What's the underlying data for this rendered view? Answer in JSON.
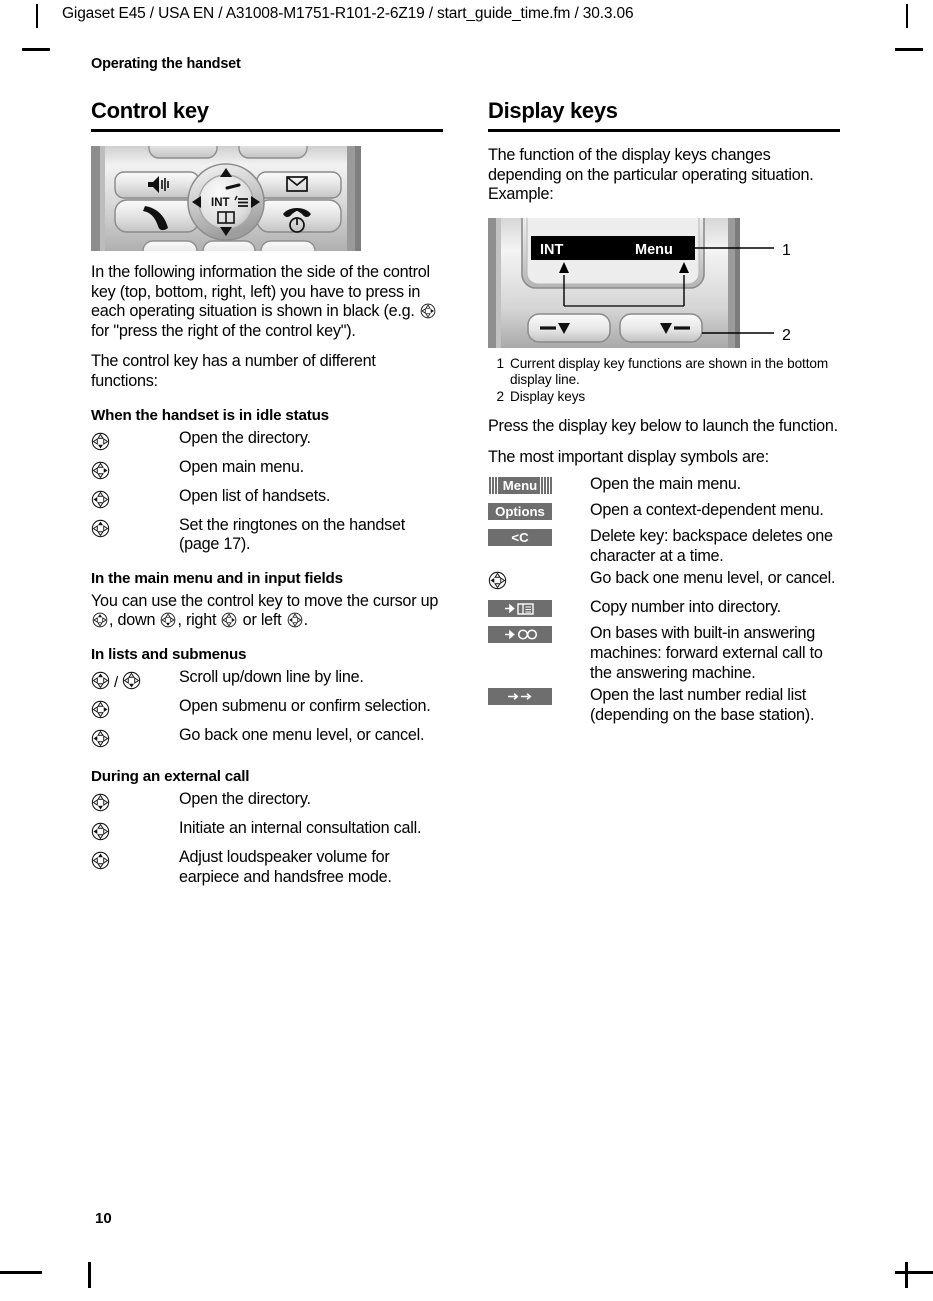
{
  "page": {
    "running_head": "Gigaset E45 / USA EN / A31008-M1751-R101-2-6Z19  / start_guide_time.fm / 30.3.06",
    "chapter": "Operating the handset",
    "folio": "10"
  },
  "left": {
    "title": "Control key",
    "figure_alt": "handset-control-key-photo",
    "figure_labels": {
      "int": "INT",
      "menu_icon": "menu-list-icon",
      "book_icon": "directory-book-icon",
      "speaker_icon": "loudspeaker-icon",
      "envelope_icon": "message-envelope-icon",
      "talk_icon": "talk-handset-icon",
      "end_icon": "end-call-power-icon"
    },
    "intro_1": "In the following information the side of the control key (top, bottom, right, left) you have to press in each operating situation is shown in black (e.g. ",
    "intro_1_tail": " for \"press the right of the control key\").",
    "intro_2": "The control key has a number of different functions:",
    "sub_idle": "When the handset is in idle status",
    "idle_rows": [
      {
        "dir": "down",
        "text": "Open the directory."
      },
      {
        "dir": "right",
        "text": "Open main menu."
      },
      {
        "dir": "left",
        "text": "Open list of handsets."
      },
      {
        "dir": "up",
        "text": "Set the ringtones on the handset (page 17)."
      }
    ],
    "sub_mainmenu": "In the main menu and in input fields",
    "mainmenu_p_a": "You can use the control key to move the cursor up ",
    "mainmenu_p_b": ", down ",
    "mainmenu_p_c": ", right ",
    "mainmenu_p_d": " or left ",
    "mainmenu_p_e": ".",
    "sub_lists": "In lists and submenus",
    "lists_rows": [
      {
        "dir": "up",
        "dir2": "down",
        "sep": "/",
        "text": "Scroll up/down line by line."
      },
      {
        "dir": "right",
        "text": "Open submenu or confirm selection."
      },
      {
        "dir": "left",
        "text": "Go back one menu level, or cancel."
      }
    ],
    "sub_call": "During an external call",
    "call_rows": [
      {
        "dir": "down",
        "text": "Open the directory."
      },
      {
        "dir": "left",
        "text": "Initiate an internal consultation call."
      },
      {
        "dir": "up",
        "text": "Adjust loudspeaker volume for earpiece and handsfree mode."
      }
    ]
  },
  "right": {
    "title": "Display keys",
    "intro": "The function of the display keys changes depending on the particular operating situation. Example:",
    "figure": {
      "alt": "handset-display-keys-photo",
      "display_left": "INT",
      "display_right": "Menu",
      "callout_1": "1",
      "callout_2": "2"
    },
    "captions": [
      {
        "n": "1",
        "text": "Current display key functions are shown in the bottom display line."
      },
      {
        "n": "2",
        "text": "Display keys"
      }
    ],
    "after_1": "Press the display key below to launch the function.",
    "after_2": "The most important display symbols are:",
    "symbols": [
      {
        "badge": "Menu",
        "style": "striped",
        "icon": "",
        "text": "Open the main menu."
      },
      {
        "badge": "Options",
        "style": "plain",
        "icon": "",
        "text": "Open a context-dependent menu."
      },
      {
        "badge": "<C",
        "style": "plain",
        "icon": "",
        "text": "Delete key: backspace deletes one character at a time."
      },
      {
        "badge": "",
        "style": "navkey",
        "icon": "nav-left-icon",
        "text": "Go back one menu level, or cancel."
      },
      {
        "badge": "",
        "style": "icon",
        "icon": "arrow-to-directory-icon",
        "text": "Copy number into directory."
      },
      {
        "badge": "",
        "style": "icon",
        "icon": "arrow-to-answering-machine-icon",
        "text": "On bases with built-in answering machines: forward external call to the answering machine."
      },
      {
        "badge": "",
        "style": "icon",
        "icon": "double-arrow-redial-icon",
        "text": "Open the last number redial list (depending on the base station)."
      }
    ]
  },
  "colors": {
    "badge_grey": "#6e6e6e",
    "display_black": "#000000",
    "photo_grey_light": "#e9e9e9",
    "photo_grey_mid": "#b9b9b9",
    "photo_grey_dark": "#6a6a6a"
  }
}
